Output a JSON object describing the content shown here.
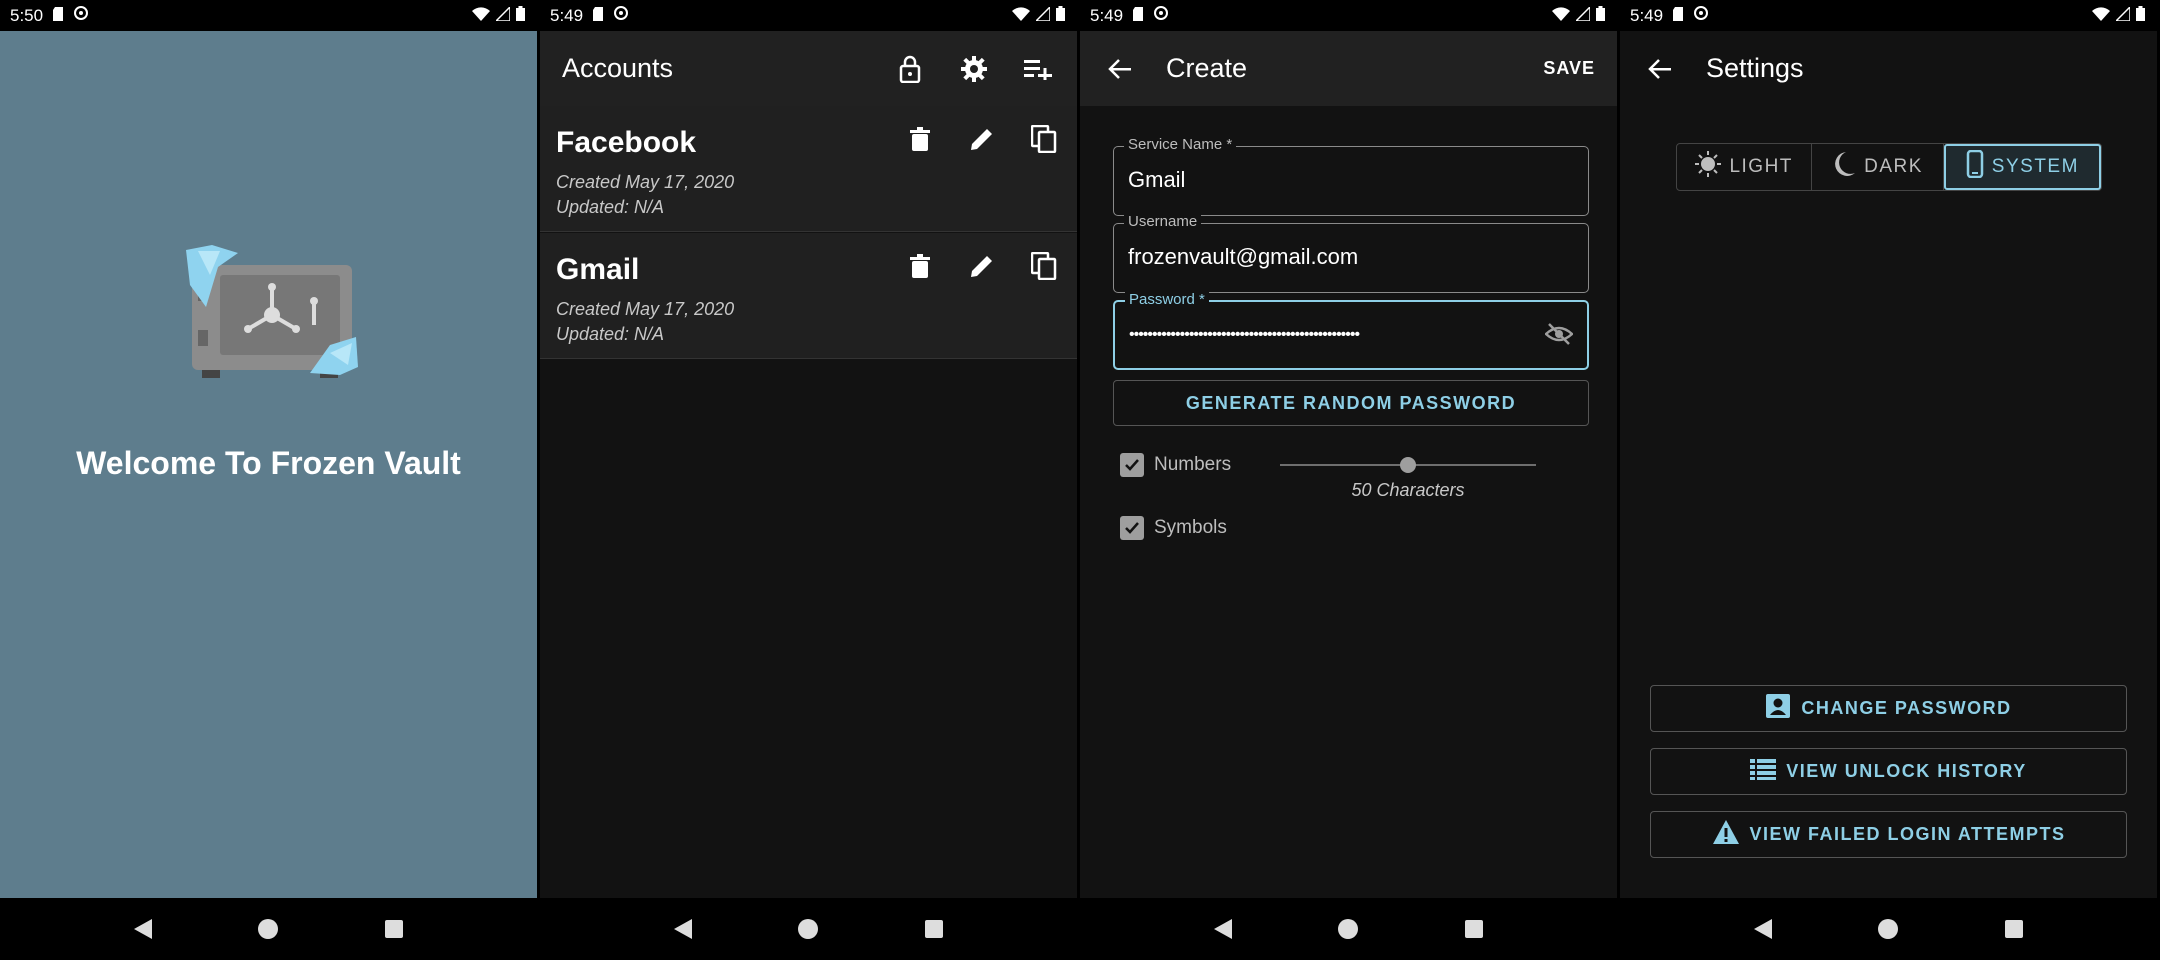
{
  "screen1": {
    "status": {
      "time": "5:50"
    },
    "welcome_title": "Welcome To Frozen Vault"
  },
  "screen2": {
    "status": {
      "time": "5:49"
    },
    "title": "Accounts",
    "accounts": [
      {
        "name": "Facebook",
        "created": "Created May 17, 2020",
        "updated": "Updated: N/A"
      },
      {
        "name": "Gmail",
        "created": "Created May 17, 2020",
        "updated": "Updated: N/A"
      }
    ]
  },
  "screen3": {
    "status": {
      "time": "5:49"
    },
    "title": "Create",
    "save_label": "SAVE",
    "service_name": {
      "label": "Service Name *",
      "value": "Gmail"
    },
    "username": {
      "label": "Username",
      "value": "frozenvault@gmail.com"
    },
    "password": {
      "label": "Password *",
      "value": "••••••••••••••••••••••••••••••••••••••••••••••••••"
    },
    "generate_label": "GENERATE RANDOM PASSWORD",
    "numbers_label": "Numbers",
    "symbols_label": "Symbols",
    "length_caption": "50 Characters",
    "length_fraction": 0.5
  },
  "screen4": {
    "status": {
      "time": "5:49"
    },
    "title": "Settings",
    "theme_options": [
      "LIGHT",
      "DARK",
      "SYSTEM"
    ],
    "theme_selected": "SYSTEM",
    "change_password_label": "CHANGE PASSWORD",
    "unlock_history_label": "VIEW UNLOCK HISTORY",
    "failed_login_label": "VIEW FAILED LOGIN ATTEMPTS"
  },
  "colors": {
    "accent": "#8ecfe6",
    "welcome_bg": "#5e7d8d",
    "surface": "#121212",
    "appbar": "#212121"
  }
}
